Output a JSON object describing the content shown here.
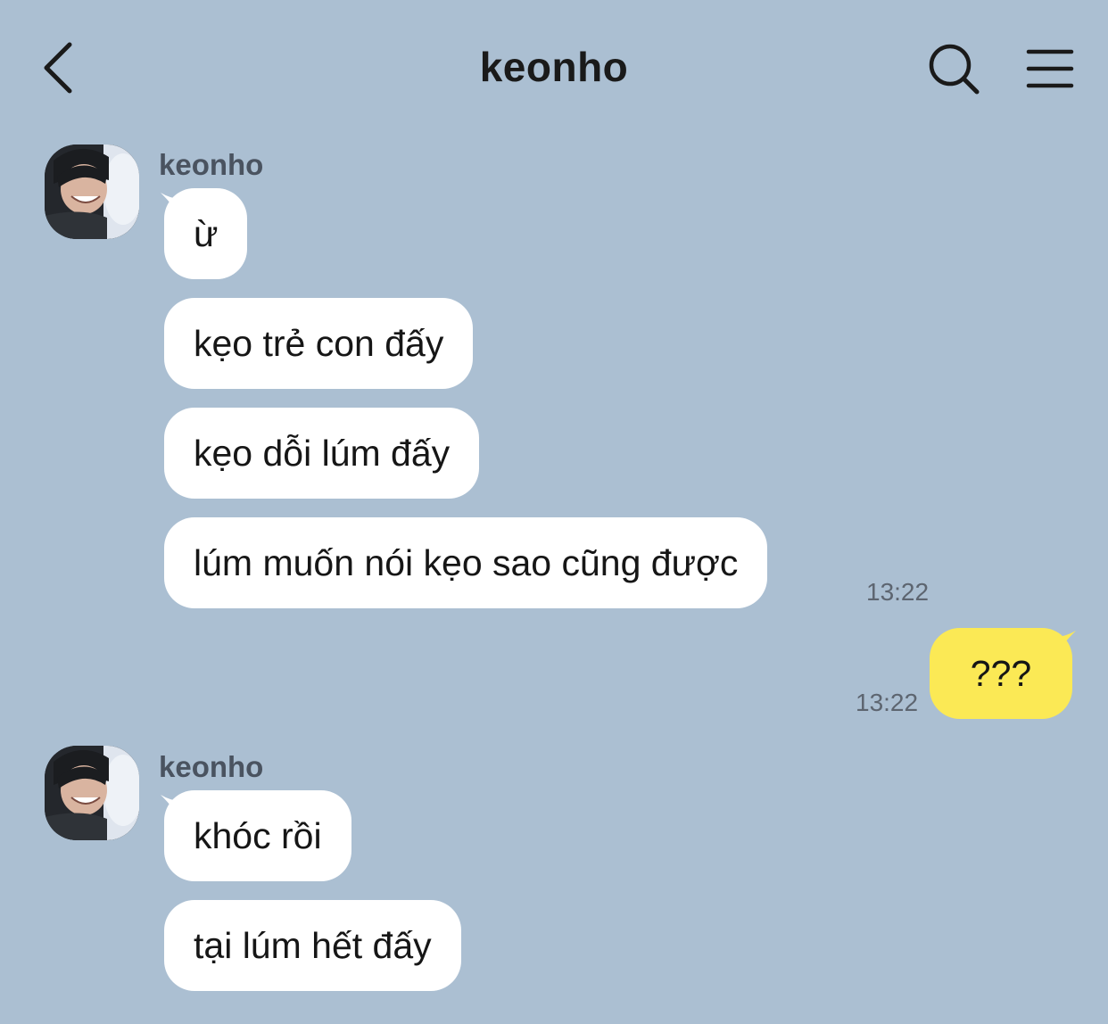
{
  "header": {
    "title": "keonho",
    "back_icon": "chevron-left-icon",
    "search_icon": "search-icon",
    "menu_icon": "hamburger-menu-icon"
  },
  "colors": {
    "background": "#abbfd2",
    "incoming_bubble": "#ffffff",
    "outgoing_bubble": "#fbe955"
  },
  "groups": [
    {
      "sender": "keonho",
      "messages": [
        "ừ",
        "kẹo trẻ con đấy",
        "kẹo dỗi lúm đấy",
        "lúm muốn nói kẹo sao cũng được"
      ],
      "time": "13:22"
    },
    {
      "mine": true,
      "messages": [
        "???"
      ],
      "time": "13:22"
    },
    {
      "sender": "keonho",
      "messages": [
        "khóc rồi",
        "tại lúm hết đấy"
      ]
    }
  ]
}
